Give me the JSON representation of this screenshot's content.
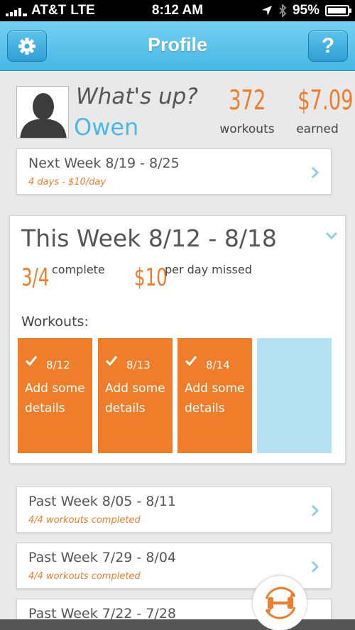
{
  "status_bar": {
    "carrier": "AT&T",
    "network": "LTE",
    "time": "8:12 AM",
    "battery": "95%",
    "battery_level": 0.95
  },
  "nav": {
    "title": "Profile",
    "left_icon": "gear-icon",
    "right_label": "?"
  },
  "profile": {
    "greeting": "What's up?",
    "name": "Owen",
    "workouts_value": "372",
    "workouts_label": "workouts",
    "earned_value": "$7.09",
    "earned_label": "earned"
  },
  "next_week": {
    "title": "Next Week 8/19 - 8/25",
    "subtitle": "4 days - $10/day"
  },
  "this_week": {
    "title": "This Week 8/12 - 8/18",
    "progress_value": "3/4",
    "progress_label": "complete",
    "penalty_value": "$10",
    "penalty_label": "per day missed",
    "workouts_heading": "Workouts:",
    "tiles": [
      {
        "date": "8/12",
        "text": "Add some details",
        "done": true
      },
      {
        "date": "8/13",
        "text": "Add some details",
        "done": true
      },
      {
        "date": "8/14",
        "text": "Add some details",
        "done": true
      },
      {
        "date": "",
        "text": "",
        "done": false
      }
    ]
  },
  "past_weeks": [
    {
      "title": "Past Week 8/05 - 8/11",
      "subtitle": "4/4 workouts completed"
    },
    {
      "title": "Past Week 7/29 - 8/04",
      "subtitle": "4/4 workouts completed"
    },
    {
      "title": "Past Week 7/22 - 7/28",
      "subtitle": ""
    }
  ],
  "colors": {
    "accent_orange": "#f07d2a",
    "accent_blue": "#4ab8e3",
    "empty_tile": "#b6e1f3"
  },
  "fab_icon": "dumbbell-refresh-icon"
}
